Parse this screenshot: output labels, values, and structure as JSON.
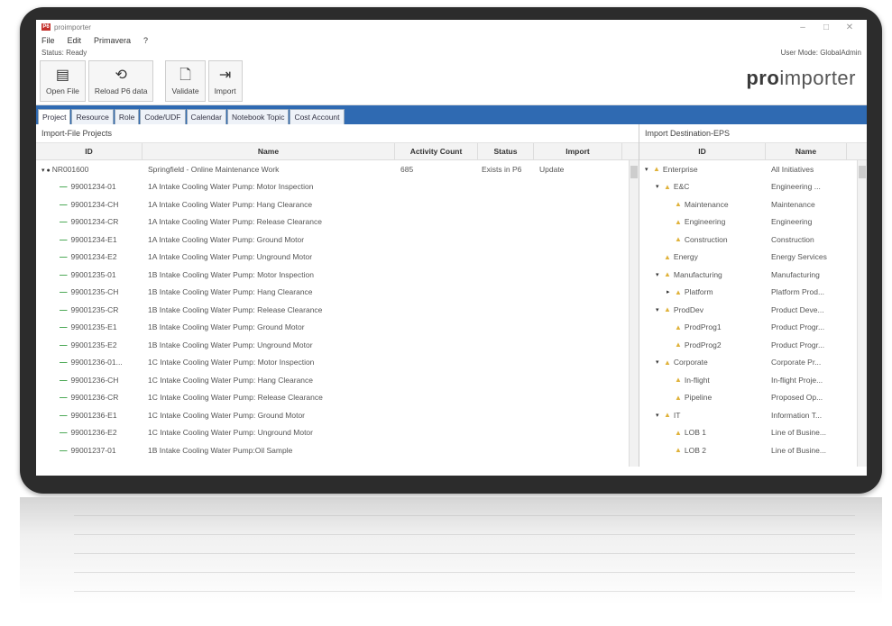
{
  "window": {
    "title": "proimporter",
    "controls": [
      "–",
      "□",
      "✕"
    ]
  },
  "menu": [
    "File",
    "Edit",
    "Primavera",
    "?"
  ],
  "status": {
    "label": "Status: Ready",
    "user_mode": "User Mode: GlobalAdmin"
  },
  "toolbar": {
    "open_file": "Open File",
    "reload": "Reload P6 data",
    "validate": "Validate",
    "import": "Import"
  },
  "logo": {
    "bold": "pro",
    "rest": "importer"
  },
  "tabs": [
    "Project",
    "Resource",
    "Role",
    "Code/UDF",
    "Calendar",
    "Notebook Topic",
    "Cost Account"
  ],
  "left_pane": {
    "title": "Import-File Projects",
    "columns": [
      "ID",
      "Name",
      "Activity Count",
      "Status",
      "Import"
    ],
    "rows": [
      {
        "id": "NR001600",
        "name": "Springfield - Online Maintenance Work",
        "activity_count": "685",
        "status": "Exists in P6",
        "import": "Update",
        "parent": true
      },
      {
        "id": "99001234-01",
        "name": "1A Intake Cooling Water Pump: Motor Inspection",
        "activity_count": "",
        "status": "",
        "import": ""
      },
      {
        "id": "99001234-CH",
        "name": "1A Intake Cooling Water Pump: Hang Clearance",
        "activity_count": "",
        "status": "",
        "import": ""
      },
      {
        "id": "99001234-CR",
        "name": "1A Intake Cooling Water Pump: Release Clearance",
        "activity_count": "",
        "status": "",
        "import": ""
      },
      {
        "id": "99001234-E1",
        "name": "1A Intake Cooling Water Pump: Ground Motor",
        "activity_count": "",
        "status": "",
        "import": ""
      },
      {
        "id": "99001234-E2",
        "name": "1A Intake Cooling Water Pump: Unground Motor",
        "activity_count": "",
        "status": "",
        "import": ""
      },
      {
        "id": "99001235-01",
        "name": "1B Intake Cooling Water Pump: Motor Inspection",
        "activity_count": "",
        "status": "",
        "import": ""
      },
      {
        "id": "99001235-CH",
        "name": "1B Intake Cooling Water Pump: Hang Clearance",
        "activity_count": "",
        "status": "",
        "import": ""
      },
      {
        "id": "99001235-CR",
        "name": "1B Intake Cooling Water Pump: Release Clearance",
        "activity_count": "",
        "status": "",
        "import": ""
      },
      {
        "id": "99001235-E1",
        "name": "1B Intake Cooling Water Pump: Ground Motor",
        "activity_count": "",
        "status": "",
        "import": ""
      },
      {
        "id": "99001235-E2",
        "name": "1B Intake Cooling Water Pump: Unground Motor",
        "activity_count": "",
        "status": "",
        "import": ""
      },
      {
        "id": "99001236-01...",
        "name": "1C Intake Cooling Water Pump: Motor Inspection",
        "activity_count": "",
        "status": "",
        "import": ""
      },
      {
        "id": "99001236-CH",
        "name": "1C Intake Cooling Water Pump: Hang Clearance",
        "activity_count": "",
        "status": "",
        "import": ""
      },
      {
        "id": "99001236-CR",
        "name": "1C Intake Cooling Water Pump: Release Clearance",
        "activity_count": "",
        "status": "",
        "import": ""
      },
      {
        "id": "99001236-E1",
        "name": "1C Intake Cooling Water Pump: Ground Motor",
        "activity_count": "",
        "status": "",
        "import": ""
      },
      {
        "id": "99001236-E2",
        "name": "1C Intake Cooling Water Pump: Unground Motor",
        "activity_count": "",
        "status": "",
        "import": ""
      },
      {
        "id": "99001237-01",
        "name": "1B Intake Cooling Water Pump:Oil Sample",
        "activity_count": "",
        "status": "",
        "import": ""
      }
    ]
  },
  "right_pane": {
    "title": "Import Destination-EPS",
    "columns": [
      "ID",
      "Name"
    ],
    "rows": [
      {
        "id": "Enterprise",
        "name": "All Initiatives",
        "level": 0,
        "expander": "▾"
      },
      {
        "id": "E&C",
        "name": "Engineering ...",
        "level": 1,
        "expander": "▾"
      },
      {
        "id": "Maintenance",
        "name": "Maintenance",
        "level": 2,
        "expander": ""
      },
      {
        "id": "Engineering",
        "name": "Engineering",
        "level": 2,
        "expander": ""
      },
      {
        "id": "Construction",
        "name": "Construction",
        "level": 2,
        "expander": ""
      },
      {
        "id": "Energy",
        "name": "Energy Services",
        "level": 1,
        "expander": ""
      },
      {
        "id": "Manufacturing",
        "name": "Manufacturing",
        "level": 1,
        "expander": "▾"
      },
      {
        "id": "Platform",
        "name": "Platform Prod...",
        "level": 2,
        "expander": "▸"
      },
      {
        "id": "ProdDev",
        "name": "Product Deve...",
        "level": 1,
        "expander": "▾"
      },
      {
        "id": "ProdProg1",
        "name": "Product Progr...",
        "level": 2,
        "expander": ""
      },
      {
        "id": "ProdProg2",
        "name": "Product Progr...",
        "level": 2,
        "expander": ""
      },
      {
        "id": "Corporate",
        "name": "Corporate Pr...",
        "level": 1,
        "expander": "▾"
      },
      {
        "id": "In-flight",
        "name": "In-flight Proje...",
        "level": 2,
        "expander": ""
      },
      {
        "id": "Pipeline",
        "name": "Proposed Op...",
        "level": 2,
        "expander": ""
      },
      {
        "id": "IT",
        "name": "Information T...",
        "level": 1,
        "expander": "▾"
      },
      {
        "id": "LOB 1",
        "name": "Line of Busine...",
        "level": 2,
        "expander": ""
      },
      {
        "id": "LOB 2",
        "name": "Line of Busine...",
        "level": 2,
        "expander": ""
      }
    ]
  }
}
